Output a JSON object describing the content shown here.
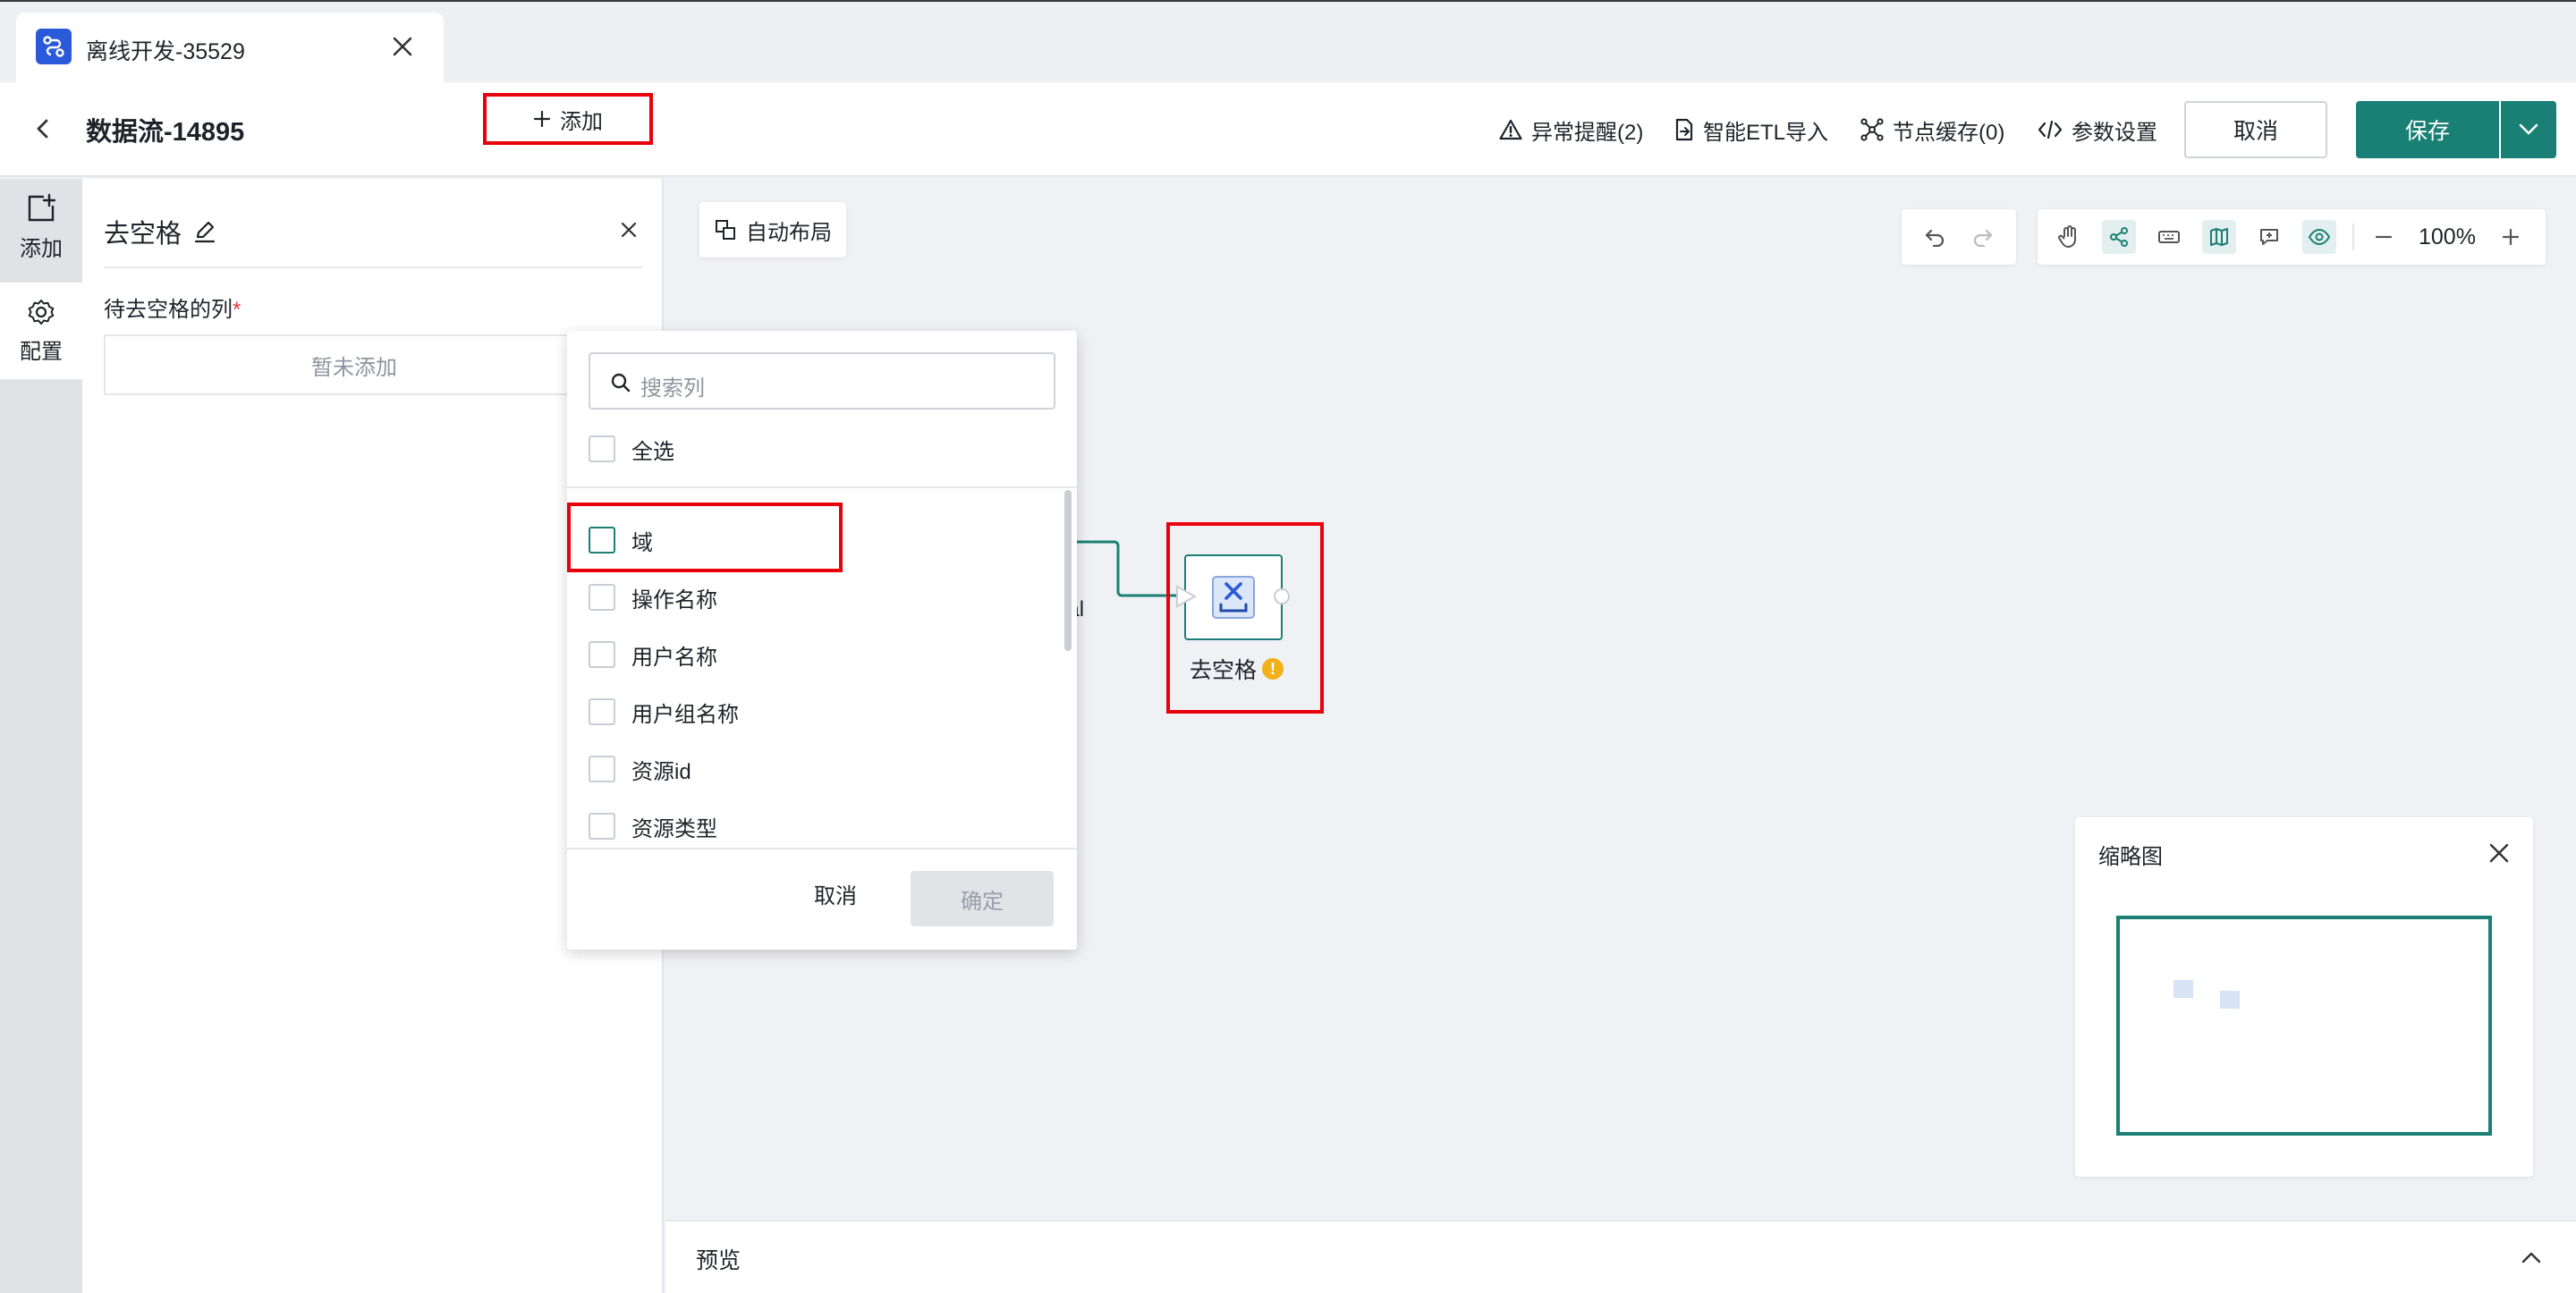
{
  "tab": {
    "title": "离线开发-35529",
    "logo_icon": "flow-icon",
    "close_icon": "close-icon"
  },
  "header": {
    "title": "数据流-14895",
    "alerts": "异常提醒(2)",
    "etl_import": "智能ETL导入",
    "node_cache": "节点缓存(0)",
    "params": "参数设置",
    "cancel": "取消",
    "save": "保存"
  },
  "rail": {
    "add": "添加",
    "config": "配置"
  },
  "panel": {
    "title": "去空格",
    "column_label": "待去空格的列",
    "required_mark": "*",
    "add_label": "添加",
    "empty_text": "暂未添加"
  },
  "canvas": {
    "auto_layout": "自动布局",
    "zoom": "100%",
    "edge_label_fragment": "nal",
    "node_label": "去空格",
    "node_warning": "!"
  },
  "dropdown": {
    "search_placeholder": "搜索列",
    "select_all": "全选",
    "items": [
      "域",
      "操作名称",
      "用户名称",
      "用户组名称",
      "资源id",
      "资源类型"
    ],
    "cancel": "取消",
    "confirm": "确定"
  },
  "minimap": {
    "title": "缩略图"
  },
  "preview": {
    "title": "预览"
  },
  "colors": {
    "primary": "#1a7f74",
    "highlight": "#e8000b",
    "warning": "#f2b11a",
    "tab_logo": "#2a5ad9"
  }
}
